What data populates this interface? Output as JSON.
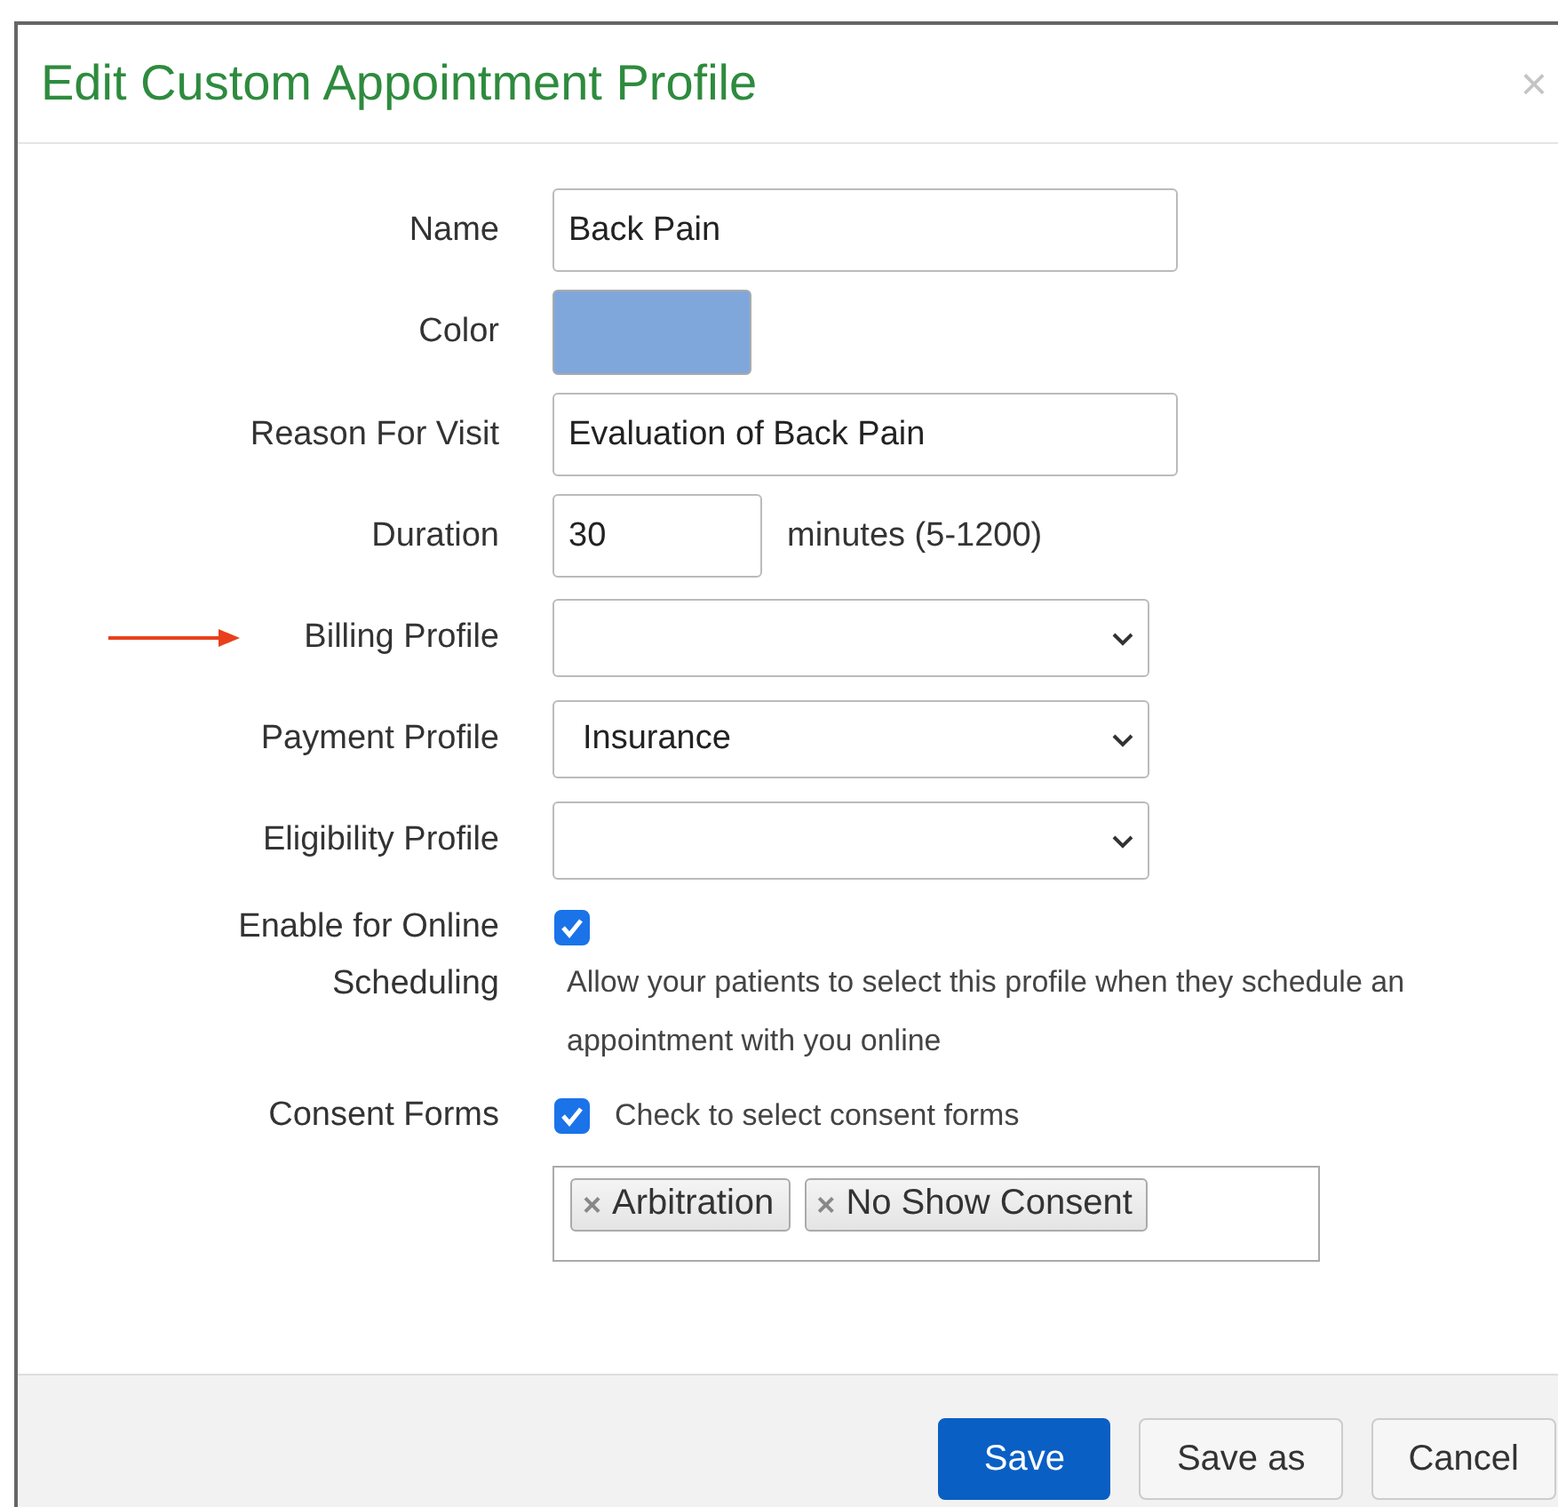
{
  "dialog": {
    "title": "Edit Custom Appointment Profile",
    "close": "×"
  },
  "fields": [
    {
      "kind": "text",
      "label": "Name",
      "value": "Back Pain",
      "arrow": false
    },
    {
      "kind": "color",
      "label": "Color",
      "color": "#7fa7dc",
      "arrow": false
    },
    {
      "kind": "text",
      "label": "Reason For Visit",
      "value": "Evaluation of Back Pain",
      "arrow": false
    },
    {
      "kind": "number",
      "label": "Duration",
      "value": "30",
      "suffix": "minutes (5-1200)",
      "arrow": false
    },
    {
      "kind": "select",
      "label": "Billing Profile",
      "arrow": true
    },
    {
      "kind": "select",
      "label": "Payment Profile",
      "value": "Insurance",
      "arrow": false
    },
    {
      "kind": "select",
      "label": "Eligibility Profile",
      "arrow": false
    },
    {
      "kind": "checkbox",
      "label": "Enable for Online Scheduling",
      "checked": true,
      "help": "Allow your patients to select this profile when they schedule an appointment with you online",
      "arrow": false
    },
    {
      "kind": "consent",
      "label": "Consent Forms",
      "checked": true,
      "check_label": "Check to select consent forms",
      "tags": [
        {
          "remove": "×",
          "label": "Arbitration"
        },
        {
          "remove": "×",
          "label": "No Show Consent"
        }
      ],
      "arrow": false
    }
  ],
  "buttons": [
    {
      "label": "Save",
      "primary": true
    },
    {
      "label": "Save as",
      "primary": false
    },
    {
      "label": "Cancel",
      "primary": false
    }
  ]
}
